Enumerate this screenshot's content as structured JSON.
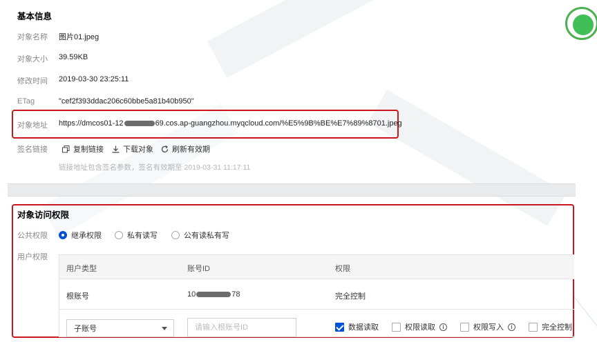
{
  "basic_info": {
    "title": "基本信息",
    "name_label": "对象名称",
    "name_value": "图片01.jpeg",
    "size_label": "对象大小",
    "size_value": "39.59KB",
    "modified_label": "修改时间",
    "modified_value": "2019-03-30 23:25:11",
    "etag_label": "ETag",
    "etag_value": "\"cef2f393ddac206c60bbe5a81b40b950\"",
    "url_label": "对象地址",
    "url_prefix": "https://dmcos01-12",
    "url_suffix": "69.cos.ap-guangzhou.myqcloud.com/%E5%9B%BE%E7%89%8701.jpeg",
    "signed_label": "签名链接",
    "actions": {
      "copy": "复制链接",
      "download": "下载对象",
      "refresh": "刷新有效期"
    },
    "hint": "链接地址包含签名参数，签名有效期至 2019-03-31 11:17:11"
  },
  "access": {
    "title": "对象访问权限",
    "public_label": "公共权限",
    "radios": [
      "继承权限",
      "私有读写",
      "公有读私有写"
    ],
    "selected_radio": 0,
    "user_label": "用户权限",
    "table": {
      "headers": [
        "用户类型",
        "账号ID",
        "权限"
      ],
      "row": {
        "type": "根账号",
        "id_prefix": "10",
        "id_suffix": "78",
        "permission": "完全控制"
      },
      "select_value": "子账号",
      "input_placeholder": "请输入根账号ID",
      "checkboxes": [
        {
          "label": "数据读取",
          "checked": true,
          "info": false
        },
        {
          "label": "权限读取",
          "checked": false,
          "info": true
        },
        {
          "label": "权限写入",
          "checked": false,
          "info": true
        },
        {
          "label": "完全控制",
          "checked": false,
          "info": false
        }
      ]
    }
  },
  "colors": {
    "highlight_border": "#c9161d",
    "primary": "#0052d9"
  }
}
